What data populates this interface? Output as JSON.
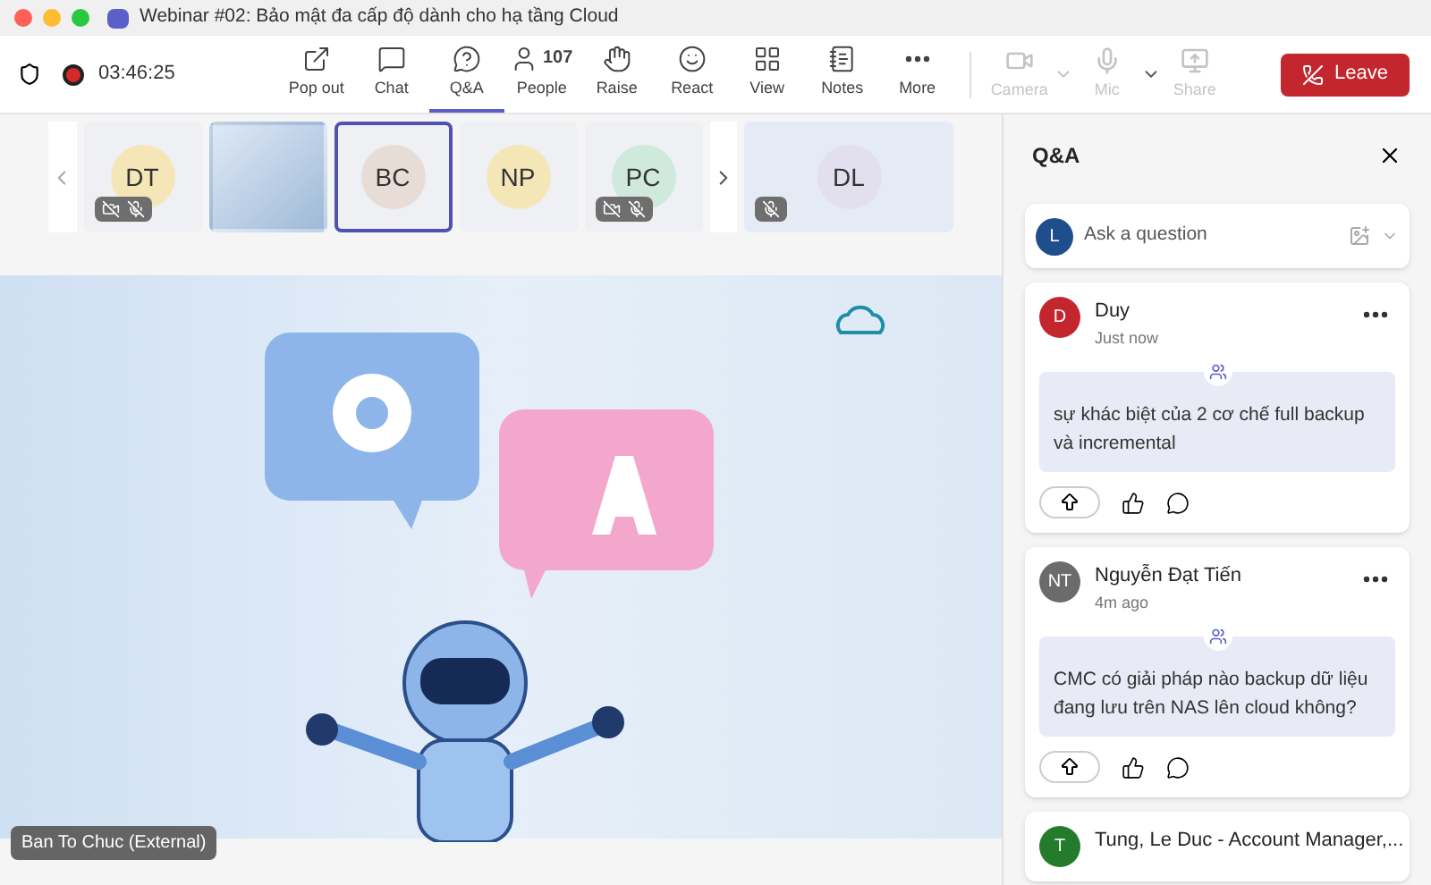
{
  "window": {
    "title": "Webinar #02: Bảo mật đa cấp độ dành cho hạ tầng Cloud"
  },
  "meeting": {
    "timer": "03:46:25",
    "recording": true
  },
  "toolbar": [
    {
      "kind": "popout",
      "label": "Pop out",
      "selected": false
    },
    {
      "kind": "chat",
      "label": "Chat",
      "selected": false
    },
    {
      "kind": "qa",
      "label": "Q&A",
      "selected": true
    },
    {
      "kind": "people",
      "label": "People",
      "count": "107",
      "selected": false
    },
    {
      "kind": "raise",
      "label": "Raise",
      "selected": false
    },
    {
      "kind": "react",
      "label": "React",
      "selected": false
    },
    {
      "kind": "view",
      "label": "View",
      "selected": false
    },
    {
      "kind": "notes",
      "label": "Notes",
      "selected": false
    },
    {
      "kind": "more",
      "label": "More",
      "selected": false
    }
  ],
  "devices": [
    {
      "kind": "camera",
      "label": "Camera",
      "disabled": true,
      "menu": true
    },
    {
      "kind": "mic",
      "label": "Mic",
      "disabled": true,
      "menu": true
    },
    {
      "kind": "share",
      "label": "Share",
      "disabled": true,
      "menu": false
    }
  ],
  "leave_button": {
    "label": "Leave"
  },
  "participants": [
    {
      "kind": "avatar",
      "initials": "DT",
      "color": "#f5e6b8",
      "camera_off": true,
      "muted": true,
      "selected": false
    },
    {
      "kind": "video",
      "selected": false
    },
    {
      "kind": "avatar",
      "initials": "BC",
      "color": "#e8dcd6",
      "camera_off": false,
      "muted": false,
      "selected": true
    },
    {
      "kind": "avatar",
      "initials": "NP",
      "color": "#f5e6b8",
      "camera_off": false,
      "muted": false,
      "selected": false
    },
    {
      "kind": "avatar",
      "initials": "PC",
      "color": "#cfe9dc",
      "camera_off": true,
      "muted": true,
      "selected": false
    },
    {
      "kind": "avatar",
      "initials": "DL",
      "color": "#e2dfee",
      "camera_off": false,
      "muted": true,
      "selected": false
    }
  ],
  "stage": {
    "presenter": "Ban To Chuc (External)"
  },
  "qa_panel": {
    "title": "Q&A",
    "ask": {
      "avatar": "L",
      "placeholder": "Ask a question"
    },
    "questions": [
      {
        "author": "Duy",
        "initials": "D",
        "color": "#c4262e",
        "time": "Just now",
        "text": "sự khác biệt của 2 cơ chế full backup và incremental"
      },
      {
        "author": "Nguyễn Đạt Tiến",
        "initials": "NT",
        "color": "#6b6b6b",
        "time": "4m ago",
        "text": "CMC có giải pháp nào backup dữ liệu đang lưu trên NAS lên cloud không?"
      },
      {
        "author": "Tung, Le Duc - Account Manager,...",
        "initials": "T",
        "color": "#237b2b"
      }
    ]
  }
}
